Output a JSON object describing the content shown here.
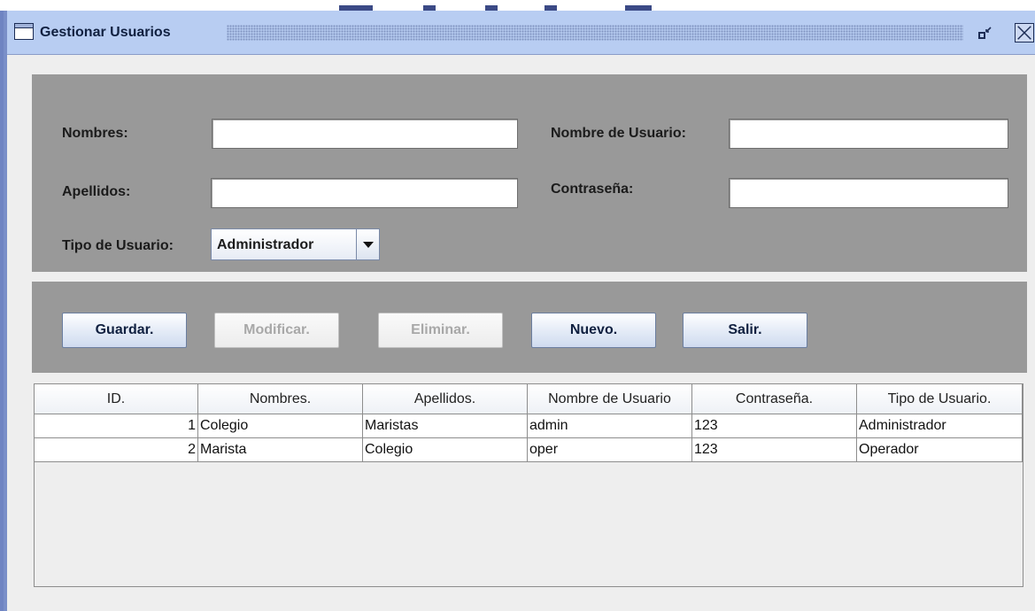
{
  "window": {
    "title": "Gestionar Usuarios",
    "icons": {
      "app": "window-icon",
      "restore": "restore-icon",
      "close": "close-icon"
    }
  },
  "form": {
    "nombres": {
      "label": "Nombres:",
      "value": ""
    },
    "apellidos": {
      "label": "Apellidos:",
      "value": ""
    },
    "nombre_usuario": {
      "label": "Nombre de Usuario:",
      "value": ""
    },
    "contrasena": {
      "label": "Contraseña:",
      "value": ""
    },
    "tipo_usuario": {
      "label": "Tipo de Usuario:",
      "selected": "Administrador"
    }
  },
  "buttons": {
    "guardar": {
      "label": "Guardar.",
      "enabled": true
    },
    "modificar": {
      "label": "Modificar.",
      "enabled": false
    },
    "eliminar": {
      "label": "Eliminar.",
      "enabled": false
    },
    "nuevo": {
      "label": "Nuevo.",
      "enabled": true
    },
    "salir": {
      "label": "Salir.",
      "enabled": true
    }
  },
  "table": {
    "columns": [
      "ID.",
      "Nombres.",
      "Apellidos.",
      "Nombre de Usuario",
      "Contraseña.",
      "Tipo de Usuario."
    ],
    "rows": [
      [
        "1",
        "Colegio",
        "Maristas",
        "admin",
        "123",
        "Administrador"
      ],
      [
        "2",
        "Marista",
        "Colegio",
        "oper",
        "123",
        "Operador"
      ]
    ]
  },
  "colors": {
    "titlebar": "#b8cdf2",
    "frame_border": "#6f84c2",
    "panel": "#999999",
    "content_bg": "#eeeeee"
  }
}
